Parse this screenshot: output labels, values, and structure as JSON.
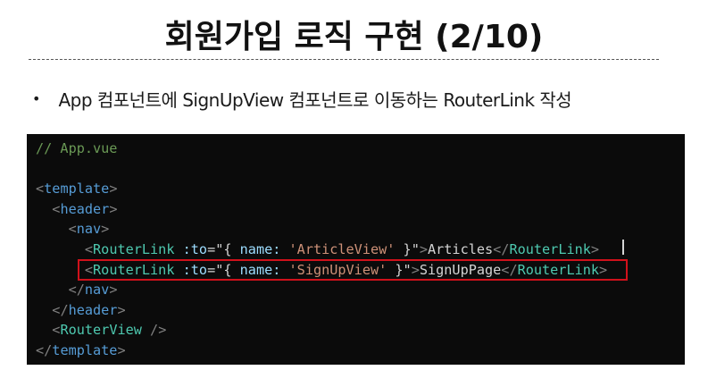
{
  "slide": {
    "title": "회원가입 로직 구현 (2/10)",
    "bullet_symbol": "•",
    "bullet_text": "App 컴포넌트에 SignUpView 컴포넌트로 이동하는 RouterLink 작성"
  },
  "code": {
    "comment": "// App.vue",
    "template_open": "template",
    "template_close": "template",
    "header_tag": "header",
    "nav_tag": "nav",
    "router_link": "RouterLink",
    "to_attr": ":to",
    "obj_open": "\"{ ",
    "name_key": "name: ",
    "obj_close": " }\"",
    "article_route": "'ArticleView'",
    "article_text": "Articles",
    "signup_route": "'SignUpView'",
    "signup_text": "SignUpPage",
    "router_view": "RouterView"
  },
  "colors": {
    "highlight_border": "#d0111b",
    "code_background": "#0b0b0b"
  }
}
